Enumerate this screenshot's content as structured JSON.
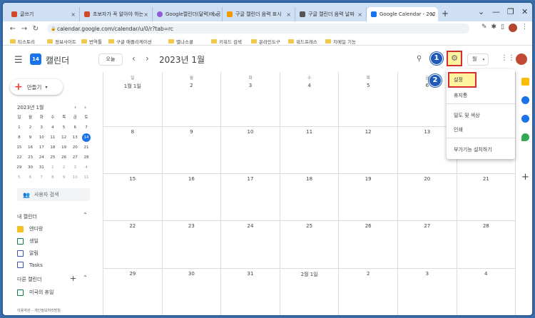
{
  "browser": {
    "tabs": [
      {
        "title": "글쓰기",
        "color": "#d04a2f"
      },
      {
        "title": "초보자가 꼭 알아야 하는",
        "color": "#d04a2f"
      },
      {
        "title": "Google캘린더(달력)에 공",
        "color": "#8e5bd6"
      },
      {
        "title": "구글 캘린더 음력 표시",
        "color": "#f29900"
      },
      {
        "title": "구글 캘린더 음력 날짜",
        "color": "#555555"
      },
      {
        "title": "Google Calendar - 202",
        "color": "#1a73e8"
      }
    ],
    "new_tab": "+",
    "url": "calendar.google.com/calendar/u/0/r?tab=rc",
    "bookmarks": [
      "티스토리",
      "정보사이트",
      "번역툴",
      "구글 애플리케이션",
      "별나스쿨",
      "키워드 검색",
      "온라인도구",
      "워드프레스",
      "지메일 기능"
    ]
  },
  "app": {
    "name": "캘린더",
    "logo_text": "14",
    "today_button": "오늘",
    "month_title": "2023년 1월",
    "view_selector": "월",
    "badge1": "1",
    "badge2": "2"
  },
  "sidebar": {
    "create_label": "만들기",
    "mini_title": "2023년 1월",
    "weekday_headers": [
      "일",
      "월",
      "화",
      "수",
      "목",
      "금",
      "토"
    ],
    "mini_weeks": [
      [
        "1",
        "2",
        "3",
        "4",
        "5",
        "6",
        "7"
      ],
      [
        "8",
        "9",
        "10",
        "11",
        "12",
        "13",
        "14"
      ],
      [
        "15",
        "16",
        "17",
        "18",
        "19",
        "20",
        "21"
      ],
      [
        "22",
        "23",
        "24",
        "25",
        "26",
        "27",
        "28"
      ],
      [
        "29",
        "30",
        "31",
        "1",
        "2",
        "3",
        "4"
      ],
      [
        "5",
        "6",
        "7",
        "8",
        "9",
        "10",
        "11"
      ]
    ],
    "user_search": "사용자 검색",
    "my_calendars_title": "내 캘린더",
    "my_calendars": [
      {
        "name": "엔디랑",
        "color": "#f6bf26",
        "checked": true
      },
      {
        "name": "생일",
        "color": "#0b8043",
        "checked": false
      },
      {
        "name": "알림",
        "color": "#3f51b5",
        "checked": false
      },
      {
        "name": "Tasks",
        "color": "#3f51b5",
        "checked": false
      }
    ],
    "other_calendars_title": "다른 캘린더",
    "other_calendars": [
      {
        "name": "미국의 휴일",
        "color": "#0b8043",
        "checked": false
      }
    ],
    "footer": "이용약관 – 개인정보처리방침"
  },
  "grid": {
    "weekday_headers": [
      "일",
      "월",
      "화",
      "수",
      "목",
      "금",
      "토"
    ],
    "weeks": [
      [
        "1월 1일",
        "2",
        "3",
        "4",
        "5",
        "6",
        "7"
      ],
      [
        "8",
        "9",
        "10",
        "11",
        "12",
        "13",
        "14"
      ],
      [
        "15",
        "16",
        "17",
        "18",
        "19",
        "20",
        "21"
      ],
      [
        "22",
        "23",
        "24",
        "25",
        "26",
        "27",
        "28"
      ],
      [
        "29",
        "30",
        "31",
        "2월 1일",
        "2",
        "3",
        "4"
      ]
    ]
  },
  "settings_menu": {
    "items": [
      "설정",
      "휴지통",
      "밀도 및 색상",
      "인쇄",
      "부가기능 설치하기"
    ]
  }
}
